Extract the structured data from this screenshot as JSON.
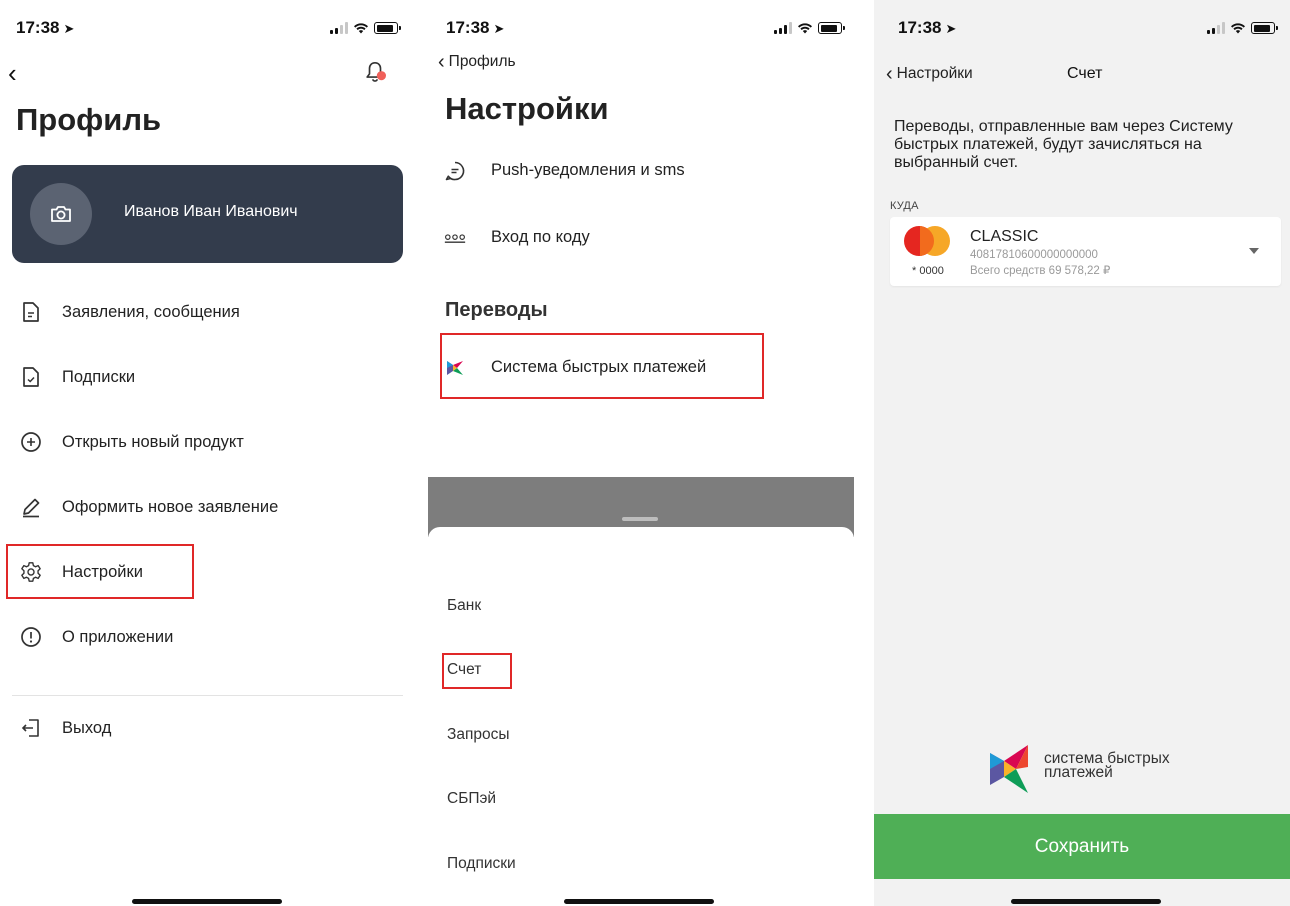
{
  "status": {
    "time": "17:38",
    "arrow": "➤"
  },
  "profile_screen": {
    "title": "Профиль",
    "user_name": "Иванов Иван Иванович",
    "menu": [
      {
        "label": "Заявления, сообщения",
        "icon": "document-icon"
      },
      {
        "label": "Подписки",
        "icon": "document-check-icon"
      },
      {
        "label": "Открыть новый продукт",
        "icon": "plus-circle-icon"
      },
      {
        "label": "Оформить новое заявление",
        "icon": "pencil-icon"
      },
      {
        "label": "Настройки",
        "icon": "gear-icon"
      },
      {
        "label": "О приложении",
        "icon": "info-circle-icon"
      }
    ],
    "logout_label": "Выход"
  },
  "settings_screen": {
    "back_label": "Профиль",
    "title": "Настройки",
    "items": [
      {
        "label": "Push-уведомления и sms",
        "icon": "chat-bubble-icon"
      },
      {
        "label": "Вход по коду",
        "icon": "pin-code-icon"
      }
    ],
    "section_transfers": "Переводы",
    "sbp_item": "Система быстрых платежей",
    "sheet_items": [
      "Банк",
      "Счет",
      "Запросы",
      "СБПэй",
      "Подписки"
    ]
  },
  "account_screen": {
    "back_label": "Настройки",
    "title": "Счет",
    "description": "Переводы, отправленные вам через Систему быстрых платежей, будут зачисляться на выбранный счет.",
    "to_label": "КУДА",
    "account": {
      "name": "CLASSIC",
      "number": "40817810600000000000",
      "mask": "* 0000",
      "balance": "Всего средств 69 578,22 ₽"
    },
    "sbp_logo_line1": "система быстрых",
    "sbp_logo_line2": "платежей",
    "save_label": "Сохранить"
  },
  "colors": {
    "profile_card": "#333c4c",
    "highlight": "#e02828",
    "save_button": "#4faf56",
    "notification_dot": "#f0605a"
  }
}
